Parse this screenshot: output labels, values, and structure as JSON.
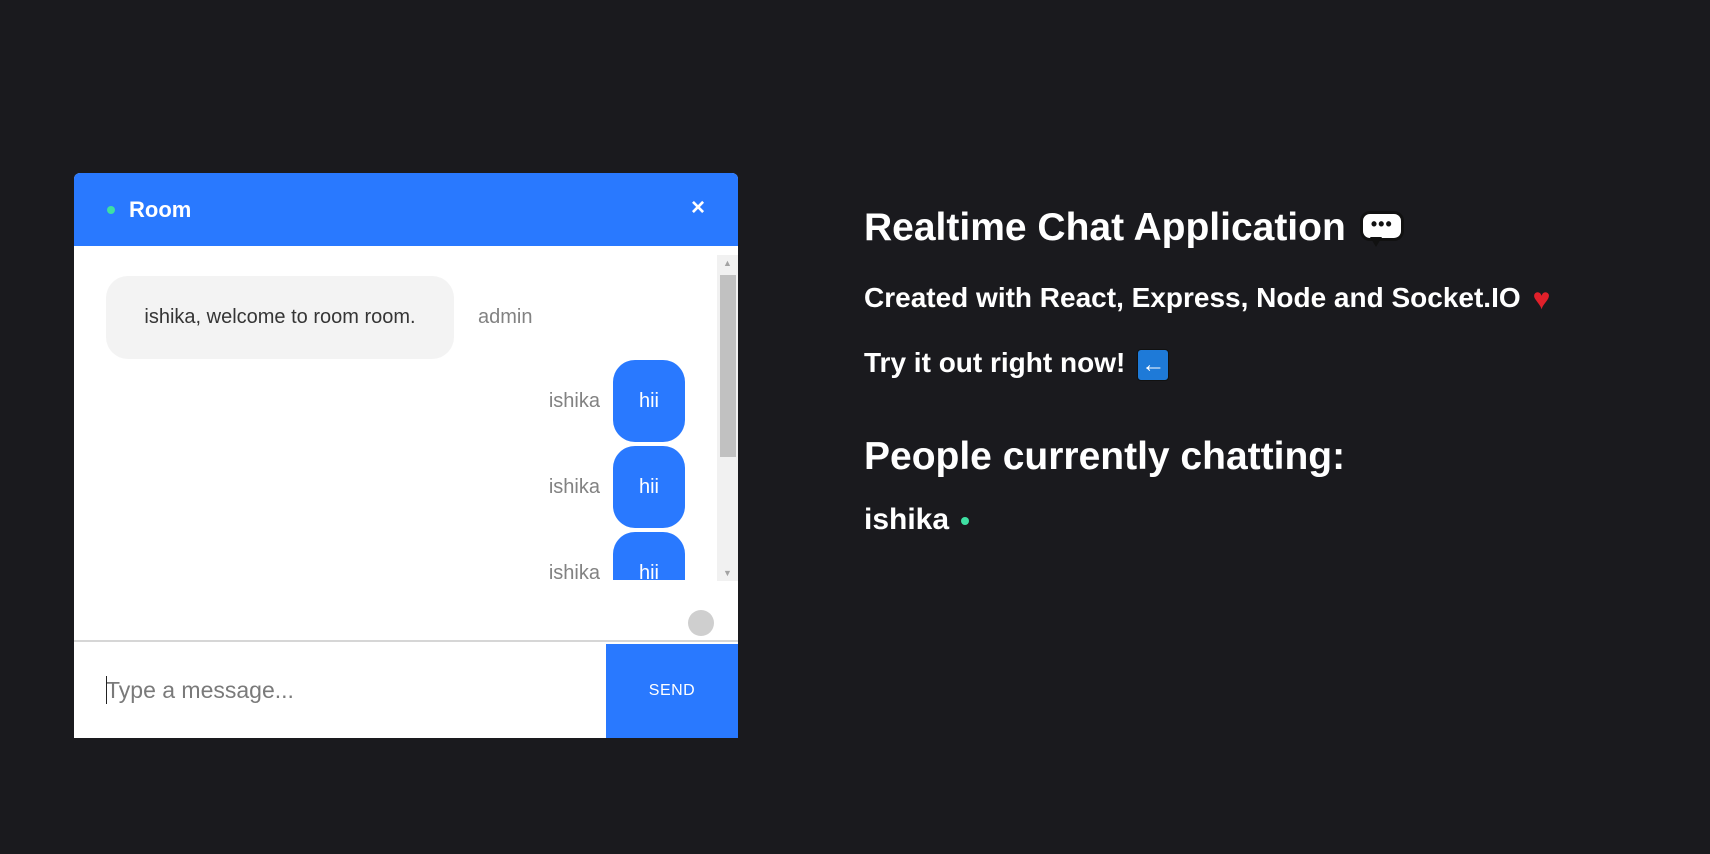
{
  "chat": {
    "room_name": "Room",
    "close_label": "×",
    "messages": [
      {
        "sender": "admin",
        "text": "ishika, welcome to room room."
      },
      {
        "sender": "ishika",
        "text": "hii"
      },
      {
        "sender": "ishika",
        "text": "hii"
      },
      {
        "sender": "ishika",
        "text": "hii"
      }
    ],
    "input_placeholder": "Type a message...",
    "send_label": "SEND"
  },
  "info": {
    "title": "Realtime Chat Application",
    "subtitle": "Created with React, Express, Node and Socket.IO",
    "try_text": "Try it out right now!",
    "people_heading": "People currently chatting:",
    "online_users": [
      "ishika"
    ]
  },
  "colors": {
    "background": "#1a1a1e",
    "accent": "#2979ff",
    "online": "#3ee0a3"
  },
  "icons": {
    "chat_emoji": "speech-balloon-icon",
    "heart_emoji": "heart-icon",
    "arrow_emoji": "left-arrow-icon"
  }
}
